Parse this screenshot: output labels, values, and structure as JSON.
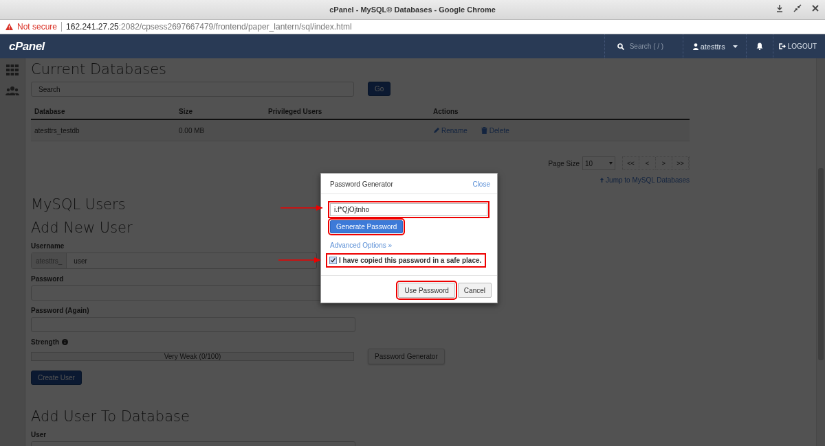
{
  "browser": {
    "title": "cPanel - MySQL® Databases - Google Chrome",
    "security_label": "Not secure",
    "url_host": "162.241.27.25",
    "url_path": ":2082/cpsess2697667479/frontend/paper_lantern/sql/index.html"
  },
  "header": {
    "logo": "cPanel",
    "search_placeholder": "Search ( / )",
    "user": "atesttrs",
    "logout": "LOGOUT"
  },
  "current_databases": {
    "title": "Current Databases",
    "search_placeholder": "Search",
    "go": "Go",
    "columns": [
      "Database",
      "Size",
      "Privileged Users",
      "Actions"
    ],
    "rows": [
      {
        "database": "atesttrs_testdb",
        "size": "0.00 MB",
        "actions": [
          "Rename",
          "Delete"
        ]
      }
    ],
    "page_size_label": "Page Size",
    "page_size": "10",
    "pager": [
      "<<",
      "<",
      ">",
      ">>"
    ],
    "jump_link": "Jump to MySQL Databases"
  },
  "mysql_users": {
    "title": "MySQL Users",
    "subtitle": "Add New User",
    "username_label": "Username",
    "username_prefix": "atesttrs_",
    "username_placeholder": "user",
    "password_label": "Password",
    "password_again_label": "Password (Again)",
    "strength_label": "Strength",
    "strength_text": "Very Weak (0/100)",
    "level": 0,
    "generator_button": "Password Generator",
    "create_button": "Create User"
  },
  "add_user_to_database": {
    "title": "Add User To Database",
    "user_label": "User"
  },
  "modal": {
    "title": "Password Generator",
    "close": "Close",
    "password": "i.f*QjOjtnho",
    "generate_button": "Generate Password",
    "advanced_link": "Advanced Options »",
    "checkbox": {
      "label": "I have copied this password in a safe place.",
      "checked": true
    },
    "use_button": "Use Password",
    "cancel_button": "Cancel"
  }
}
